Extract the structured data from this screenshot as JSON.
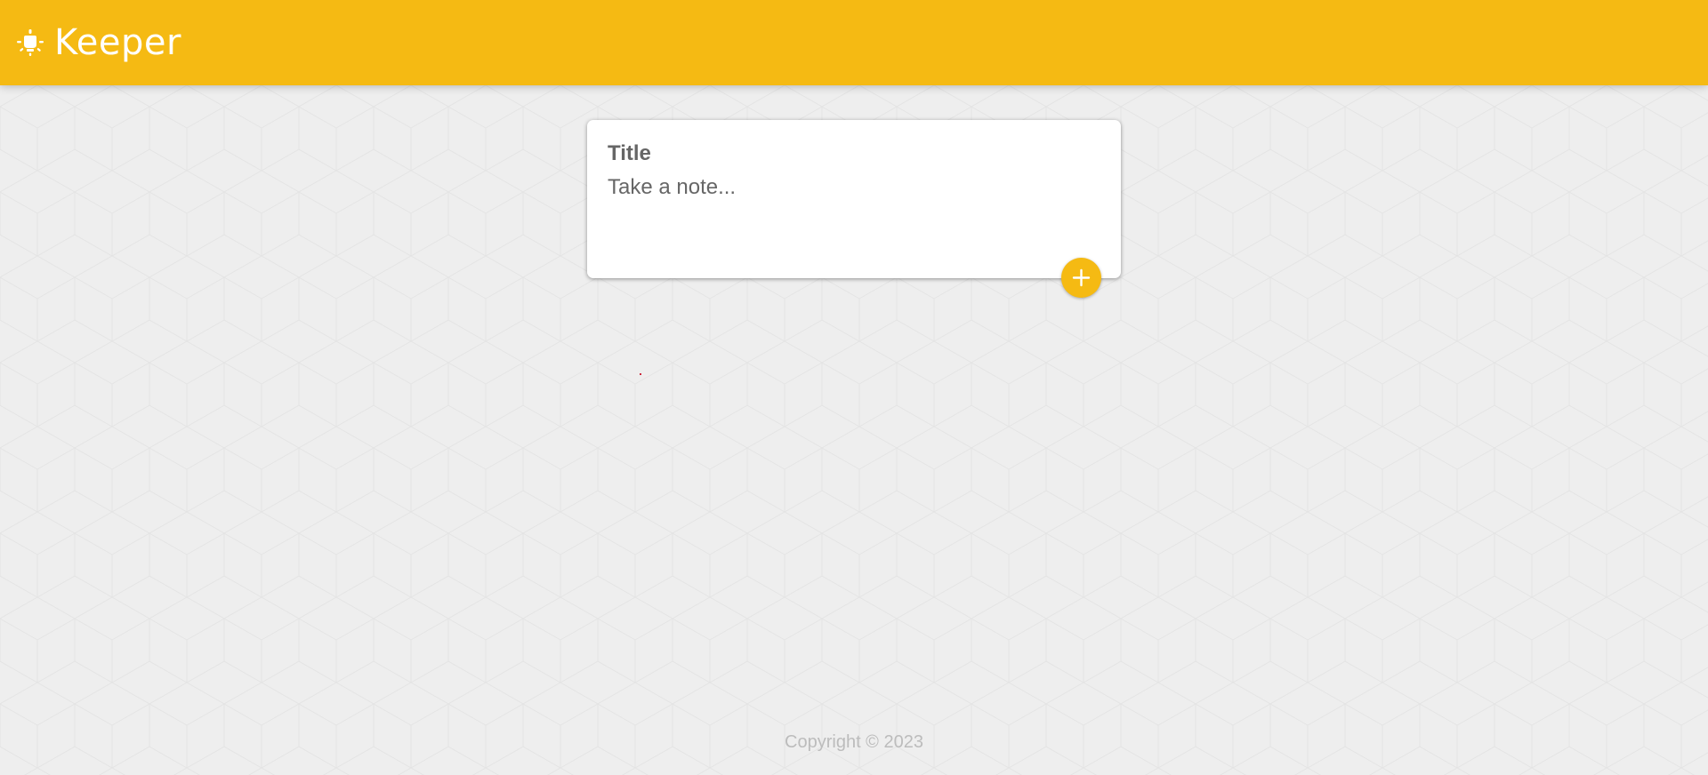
{
  "header": {
    "title": "Keeper",
    "logo_icon": "lightbulb-icon"
  },
  "note_form": {
    "title_placeholder": "Title",
    "content_placeholder": "Take a note...",
    "add_button_icon": "plus-icon"
  },
  "footer": {
    "copyright": "Copyright © 2023"
  },
  "colors": {
    "accent": "#f5ba13",
    "background": "#eeeeee",
    "card": "#ffffff",
    "footer_text": "#bcbcbc"
  }
}
